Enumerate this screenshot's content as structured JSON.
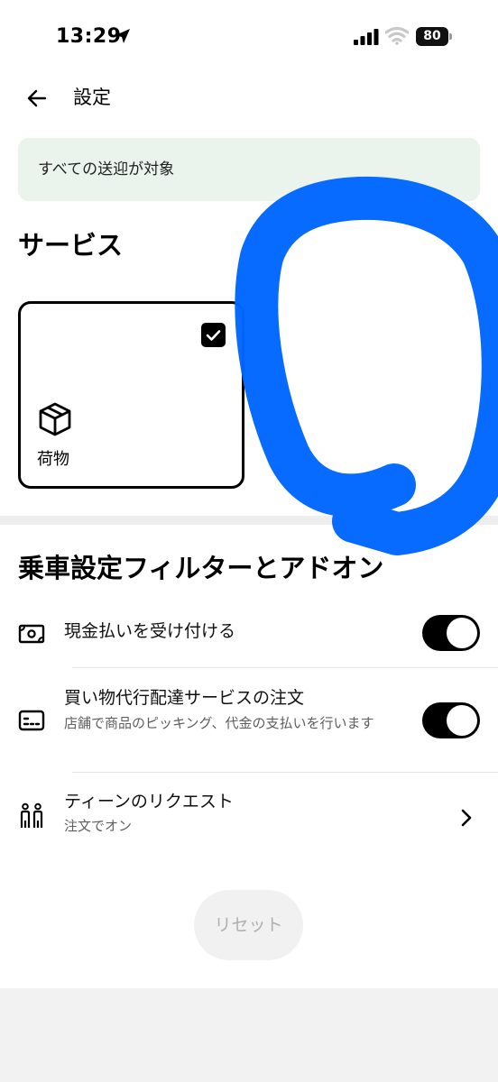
{
  "status_bar": {
    "time": "13:29",
    "battery": "80"
  },
  "header": {
    "title": "設定"
  },
  "banner": {
    "text": "すべての送迎が対象"
  },
  "services": {
    "title": "サービス",
    "card": {
      "label": "荷物",
      "checked": true
    }
  },
  "filters": {
    "title": "乗車設定フィルターとアドオン",
    "rows": [
      {
        "title": "現金払いを受け付ける",
        "icon": "cash-icon",
        "toggle": true
      },
      {
        "title": "買い物代行配達サービスの注文",
        "subtitle": "店舗で商品のピッキング、代金の支払いを行います",
        "icon": "card-icon",
        "toggle": true
      },
      {
        "title": "ティーンのリクエスト",
        "subtitle": "注文でオン",
        "icon": "teens-icon"
      }
    ]
  },
  "reset_label": "リセット",
  "colors": {
    "banner_bg": "#eaf3ec",
    "annotation": "#0066ff",
    "toggle_on": "#000000"
  }
}
